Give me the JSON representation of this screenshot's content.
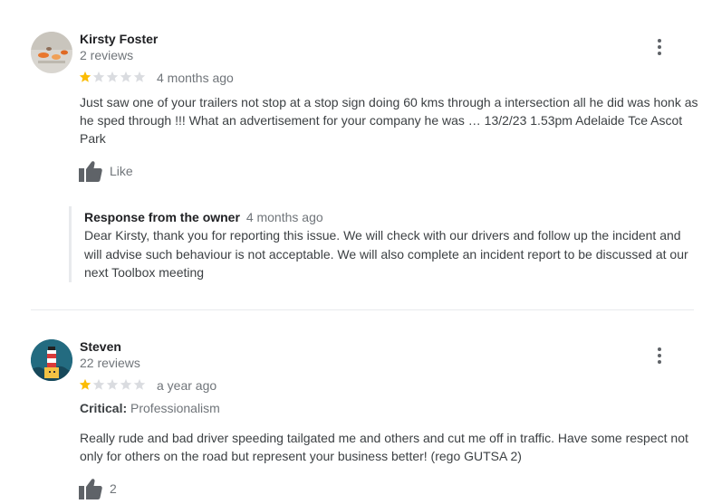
{
  "reviews": [
    {
      "name": "Kirsty Foster",
      "count": "2 reviews",
      "rating": 1,
      "ago": "4 months ago",
      "text": "Just saw one of your trailers not stop at a stop sign doing 60 kms through a intersection all he did was honk as he sped through !!! What an advertisement for your company he was … 13/2/23 1.53pm Adelaide Tce Ascot Park",
      "like_label": "Like",
      "owner_response": {
        "title": "Response from the owner",
        "ago": "4 months ago",
        "text": "Dear Kirsty, thank you for reporting this issue. We will check with our drivers and follow up the incident and will advise such behaviour is not acceptable. We will also complete an incident report to be discussed at our next Toolbox meeting"
      }
    },
    {
      "name": "Steven",
      "count": "22 reviews",
      "rating": 1,
      "ago": "a year ago",
      "critical_label": "Critical:",
      "critical_value": "Professionalism",
      "text": "Really rude and bad driver speeding tailgated me and others and cut me off in traffic. Have some respect not only for others on the road but represent your business better! (rego GUTSA 2)",
      "like_count": "2"
    }
  ],
  "colors": {
    "star_filled": "#fbbc04",
    "star_empty": "#dadce0",
    "muted": "#70757a",
    "icon": "#5f6368"
  },
  "icons": [
    "more-vert-icon",
    "star-icon",
    "thumb-up-icon"
  ]
}
